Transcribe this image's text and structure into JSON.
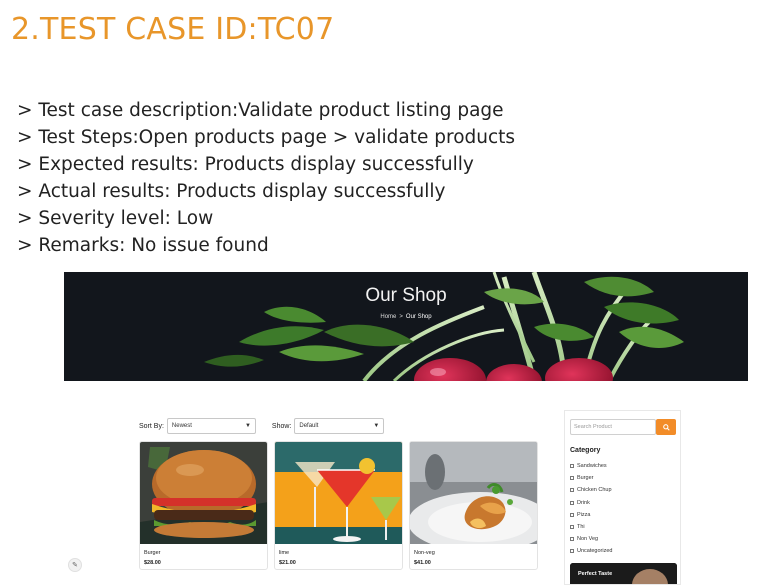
{
  "slide": {
    "title": "2.TEST CASE ID:TC07",
    "bullets": [
      "> Test case description:Validate product listing page",
      "> Test Steps:Open products page > validate products",
      "> Expected results: Products display successfully",
      "> Actual results: Products display successfully",
      "> Severity level: Low",
      "> Remarks: No issue found"
    ]
  },
  "shop": {
    "hero_title": "Our Shop",
    "breadcrumb": {
      "home": "Home",
      "separator": ">",
      "current": "Our Shop"
    },
    "sort_label": "Sort By:",
    "sort_value": "Newest",
    "show_label": "Show:",
    "show_value": "Default",
    "products": [
      {
        "name": "Burger",
        "price": "$28.00",
        "image": "burger-photo"
      },
      {
        "name": "lime",
        "price": "$21.00",
        "image": "cocktail-photo"
      },
      {
        "name": "Non-veg",
        "price": "$41.00",
        "image": "non-veg-dish-photo"
      }
    ],
    "sidebar": {
      "search_placeholder": "Search Product",
      "category_title": "Category",
      "categories": [
        "Sandwiches",
        "Burger",
        "Chicken Chup",
        "Drink",
        "Pizza",
        "Thi",
        "Non Veg",
        "Uncategorized"
      ],
      "promo_title": "Perfect Taste"
    }
  },
  "colors": {
    "accent": "#e8962a",
    "button": "#f28c28",
    "hero_bg": "#12161c"
  },
  "icons": {
    "search": "search-icon",
    "widget": "edit-widget-icon",
    "dropdown": "chevron-down-icon"
  }
}
